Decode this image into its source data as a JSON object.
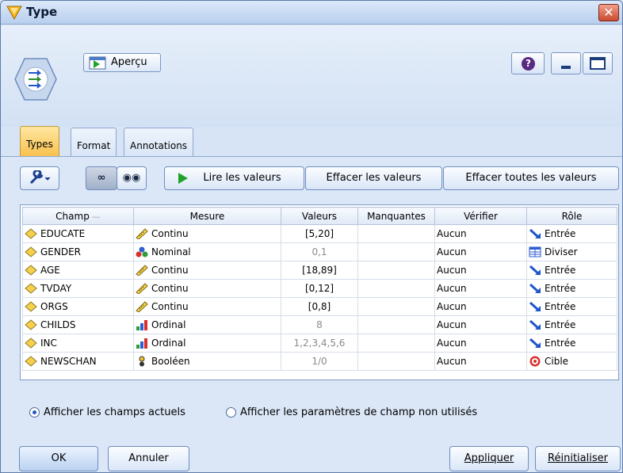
{
  "window": {
    "title": "Type"
  },
  "toolbar": {
    "preview_label": "Aperçu"
  },
  "tabs": [
    {
      "label": "Types",
      "active": true
    },
    {
      "label": "Format",
      "active": false
    },
    {
      "label": "Annotations",
      "active": false
    }
  ],
  "actions": {
    "read_values": "Lire les valeurs",
    "clear_values": "Effacer les valeurs",
    "clear_all_values": "Effacer toutes les valeurs"
  },
  "grid": {
    "columns": [
      "Champ",
      "Mesure",
      "Valeurs",
      "Manquantes",
      "Vérifier",
      "Rôle"
    ],
    "rows": [
      {
        "champ": "EDUCATE",
        "mesure": "Continu",
        "mesure_icon": "ruler-icon",
        "valeurs": "[5,20]",
        "valeurs_muted": false,
        "manquantes": "",
        "verifier": "Aucun",
        "role": "Entrée",
        "role_icon": "input-arrow-icon"
      },
      {
        "champ": "GENDER",
        "mesure": "Nominal",
        "mesure_icon": "nominal-balls-icon",
        "valeurs": "0,1",
        "valeurs_muted": true,
        "manquantes": "",
        "verifier": "Aucun",
        "role": "Diviser",
        "role_icon": "split-table-icon"
      },
      {
        "champ": "AGE",
        "mesure": "Continu",
        "mesure_icon": "ruler-icon",
        "valeurs": "[18,89]",
        "valeurs_muted": false,
        "manquantes": "",
        "verifier": "Aucun",
        "role": "Entrée",
        "role_icon": "input-arrow-icon"
      },
      {
        "champ": "TVDAY",
        "mesure": "Continu",
        "mesure_icon": "ruler-icon",
        "valeurs": "[0,12]",
        "valeurs_muted": false,
        "manquantes": "",
        "verifier": "Aucun",
        "role": "Entrée",
        "role_icon": "input-arrow-icon"
      },
      {
        "champ": "ORGS",
        "mesure": "Continu",
        "mesure_icon": "ruler-icon",
        "valeurs": "[0,8]",
        "valeurs_muted": false,
        "manquantes": "",
        "verifier": "Aucun",
        "role": "Entrée",
        "role_icon": "input-arrow-icon"
      },
      {
        "champ": "CHILDS",
        "mesure": "Ordinal",
        "mesure_icon": "ordinal-bars-icon",
        "valeurs": "8",
        "valeurs_muted": true,
        "manquantes": "",
        "verifier": "Aucun",
        "role": "Entrée",
        "role_icon": "input-arrow-icon"
      },
      {
        "champ": "INC",
        "mesure": "Ordinal",
        "mesure_icon": "ordinal-bars-icon",
        "valeurs": "1,2,3,4,5,6",
        "valeurs_muted": true,
        "manquantes": "",
        "verifier": "Aucun",
        "role": "Entrée",
        "role_icon": "input-arrow-icon"
      },
      {
        "champ": "NEWSCHAN",
        "mesure": "Booléen",
        "mesure_icon": "boolean-icon",
        "valeurs": "1/0",
        "valeurs_muted": true,
        "manquantes": "",
        "verifier": "Aucun",
        "role": "Cible",
        "role_icon": "target-icon"
      }
    ]
  },
  "options": {
    "show_current": "Afficher les champs actuels",
    "show_unused": "Afficher les paramètres de champ non utilisés",
    "selected": "show_current"
  },
  "buttons": {
    "ok": "OK",
    "cancel": "Annuler",
    "apply": "Appliquer",
    "reset": "Réinitialiser"
  },
  "colors": {
    "active_tab": "#f8c24e",
    "window_bg": "#d6e4f5",
    "accent_blue": "#1f55c9"
  }
}
